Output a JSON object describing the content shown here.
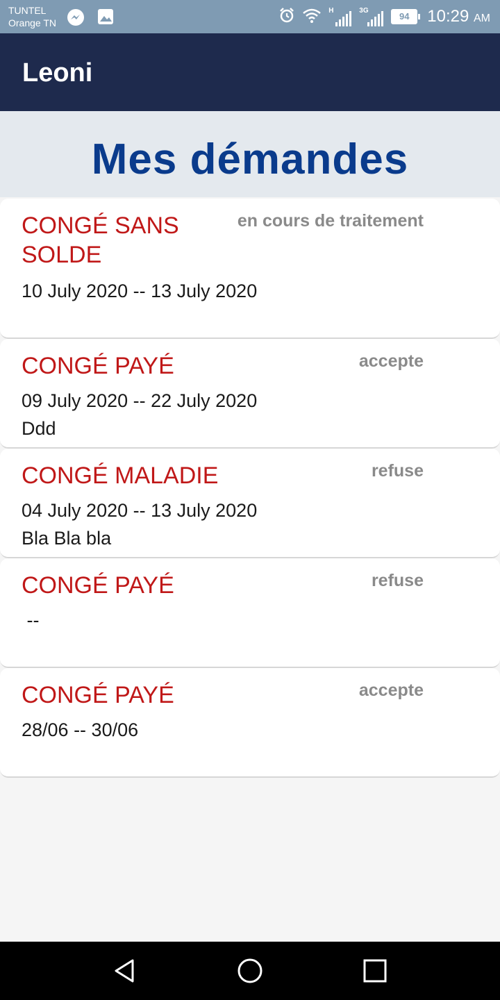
{
  "status_bar": {
    "carrier_line1": "TUNTEL",
    "carrier_line2": "Orange TN",
    "battery": "94",
    "time": "10:29",
    "ampm": "AM",
    "network1": "H",
    "network2": "3G",
    "icons": [
      "messenger-icon",
      "image-icon",
      "alarm-icon",
      "wifi-icon",
      "signal-icon",
      "signal-icon",
      "battery-icon"
    ]
  },
  "app_bar": {
    "title": "Leoni"
  },
  "header": {
    "title": "Mes démandes"
  },
  "requests": [
    {
      "type": "CONGÉ SANS SOLDE",
      "status": "en cours de traitement",
      "dates": "10 July 2020 -- 13 July 2020",
      "comment": ""
    },
    {
      "type": "CONGÉ PAYÉ",
      "status": "accepte",
      "dates": "09 July 2020 -- 22 July 2020",
      "comment": "Ddd"
    },
    {
      "type": "CONGÉ MALADIE",
      "status": "refuse",
      "dates": "04 July 2020 -- 13 July 2020",
      "comment": "Bla Bla bla"
    },
    {
      "type": "CONGÉ PAYÉ",
      "status": "refuse",
      "dates": " --",
      "comment": ""
    },
    {
      "type": "CONGÉ PAYÉ",
      "status": "accepte",
      "dates": "28/06 -- 30/06",
      "comment": ""
    }
  ],
  "colors": {
    "status_bar": "#7f9bb3",
    "app_bar": "#1e2a4d",
    "header_bg": "#e4e9ee",
    "title": "#0a3b8c",
    "request_type": "#c01818",
    "status_text": "#8a8a8a"
  },
  "nav_bar": {
    "icons": [
      "back-icon",
      "home-icon",
      "recents-icon"
    ]
  }
}
